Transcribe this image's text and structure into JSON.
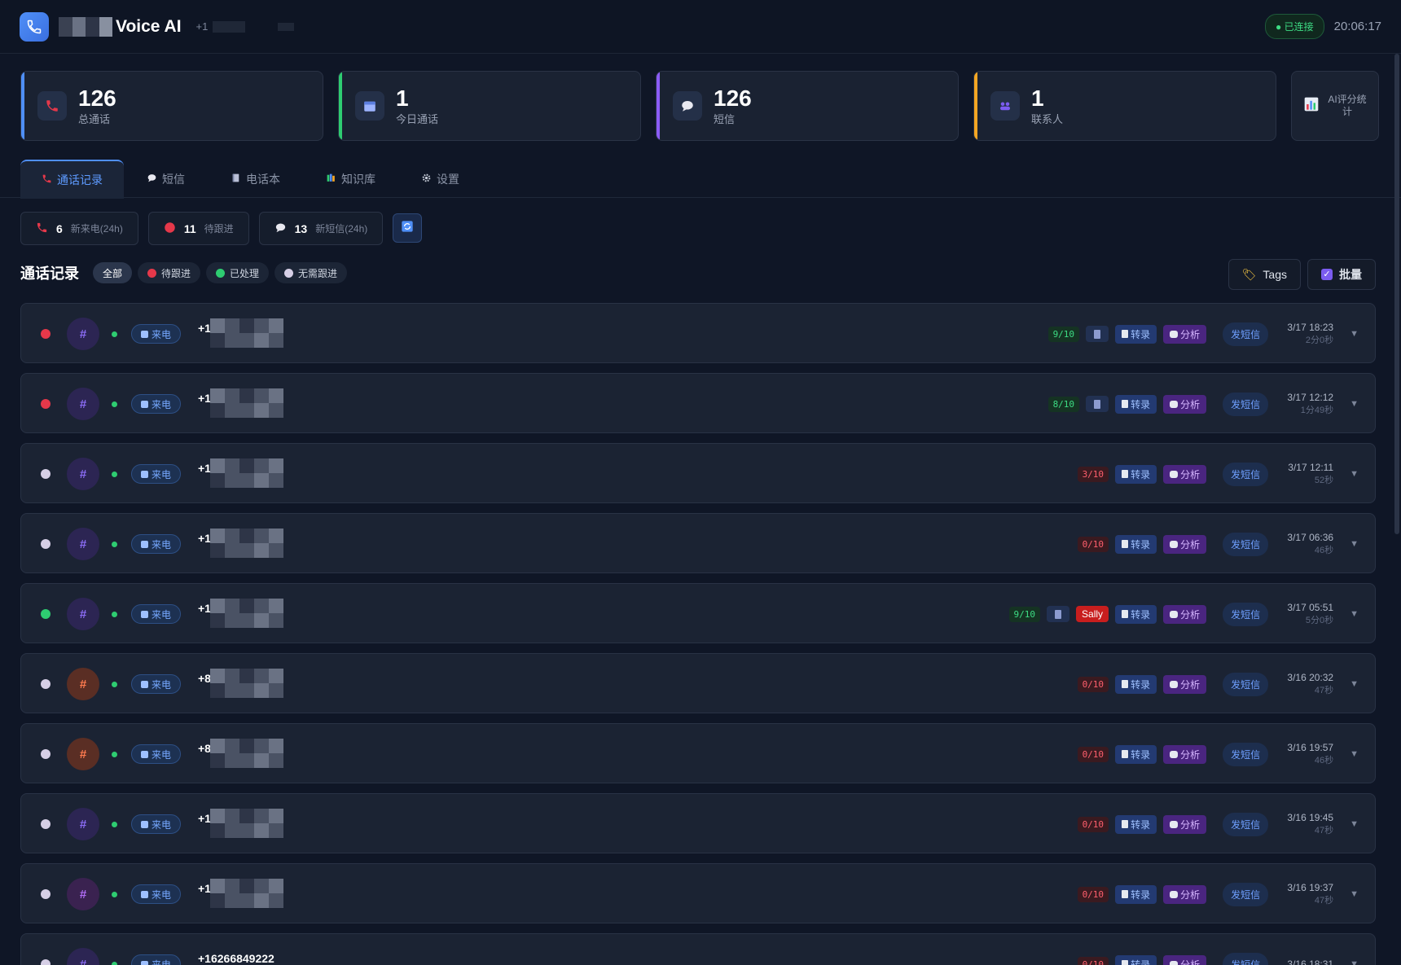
{
  "app": {
    "title": "Voice AI",
    "phone_prefix": "+1",
    "status": "已连接",
    "clock": "20:06:17"
  },
  "stats": [
    {
      "value": "126",
      "label": "总通话",
      "icon": "phone-icon",
      "accent": "#4f8ff7"
    },
    {
      "value": "1",
      "label": "今日通话",
      "icon": "calendar-icon",
      "accent": "#2ecc71"
    },
    {
      "value": "126",
      "label": "短信",
      "icon": "message-icon",
      "accent": "#8b5cf6"
    },
    {
      "value": "1",
      "label": "联系人",
      "icon": "contacts-icon",
      "accent": "#f5a623"
    }
  ],
  "ai_stats": {
    "label": "AI评分统计",
    "icon": "bar-chart-icon"
  },
  "tabs": [
    {
      "label": "通话记录",
      "icon": "phone-icon",
      "active": true
    },
    {
      "label": "短信",
      "icon": "message-icon"
    },
    {
      "label": "电话本",
      "icon": "book-icon"
    },
    {
      "label": "知识库",
      "icon": "books-icon"
    },
    {
      "label": "设置",
      "icon": "gear-icon"
    }
  ],
  "quick": [
    {
      "num": "6",
      "label": "新来电(24h)",
      "icon": "phone-icon"
    },
    {
      "num": "11",
      "label": "待跟进",
      "icon": "red-circle-icon"
    },
    {
      "num": "13",
      "label": "新短信(24h)",
      "icon": "message-icon"
    }
  ],
  "filters": {
    "title": "通话记录",
    "chips": [
      {
        "label": "全部",
        "active": true
      },
      {
        "label": "待跟进",
        "dot": "#e5384a"
      },
      {
        "label": "已处理",
        "dot": "#2ecc71"
      },
      {
        "label": "无需跟进",
        "dot": "#d6cfe6"
      }
    ],
    "tags_label": "Tags",
    "batch_label": "批量"
  },
  "row_labels": {
    "direction": "来电",
    "transcribe": "转录",
    "analyze": "分析",
    "sms": "发短信"
  },
  "calls": [
    {
      "status": "#e5384a",
      "avatar_bg": "#2c2553",
      "avatar_fg": "#8b6cf5",
      "num": "+1",
      "score": "9/10",
      "good": true,
      "icon": true,
      "tag": "",
      "date": "3/17 18:23",
      "dur": "2分0秒"
    },
    {
      "status": "#e5384a",
      "avatar_bg": "#2c2553",
      "avatar_fg": "#8b6cf5",
      "num": "+1",
      "score": "8/10",
      "good": true,
      "icon": true,
      "tag": "",
      "date": "3/17 12:12",
      "dur": "1分49秒"
    },
    {
      "status": "#d6cfe6",
      "avatar_bg": "#2c2553",
      "avatar_fg": "#8b6cf5",
      "num": "+1",
      "score": "3/10",
      "good": false,
      "icon": false,
      "tag": "",
      "date": "3/17 12:11",
      "dur": "52秒"
    },
    {
      "status": "#d6cfe6",
      "avatar_bg": "#2c2553",
      "avatar_fg": "#8b6cf5",
      "num": "+1",
      "score": "0/10",
      "good": false,
      "icon": false,
      "tag": "",
      "date": "3/17 06:36",
      "dur": "46秒"
    },
    {
      "status": "#2ecc71",
      "avatar_bg": "#2c2553",
      "avatar_fg": "#8b6cf5",
      "num": "+1",
      "score": "9/10",
      "good": true,
      "icon": true,
      "tag": "Sally",
      "date": "3/17 05:51",
      "dur": "5分0秒"
    },
    {
      "status": "#d6cfe6",
      "avatar_bg": "#5a2e24",
      "avatar_fg": "#ff7b4f",
      "num": "+8",
      "score": "0/10",
      "good": false,
      "icon": false,
      "tag": "",
      "date": "3/16 20:32",
      "dur": "47秒"
    },
    {
      "status": "#d6cfe6",
      "avatar_bg": "#5a2e24",
      "avatar_fg": "#ff7b4f",
      "num": "+8",
      "score": "0/10",
      "good": false,
      "icon": false,
      "tag": "",
      "date": "3/16 19:57",
      "dur": "46秒"
    },
    {
      "status": "#d6cfe6",
      "avatar_bg": "#2c2553",
      "avatar_fg": "#8b6cf5",
      "num": "+1",
      "score": "0/10",
      "good": false,
      "icon": false,
      "tag": "",
      "date": "3/16 19:45",
      "dur": "47秒"
    },
    {
      "status": "#d6cfe6",
      "avatar_bg": "#3a2250",
      "avatar_fg": "#b06cf5",
      "num": "+1",
      "score": "0/10",
      "good": false,
      "icon": false,
      "tag": "",
      "date": "3/16 19:37",
      "dur": "47秒"
    },
    {
      "status": "#d6cfe6",
      "avatar_bg": "#2c2553",
      "avatar_fg": "#8b6cf5",
      "num": "+16266849222",
      "score": "0/10",
      "good": false,
      "icon": false,
      "tag": "",
      "date": "3/16 18:31",
      "dur": ""
    }
  ]
}
